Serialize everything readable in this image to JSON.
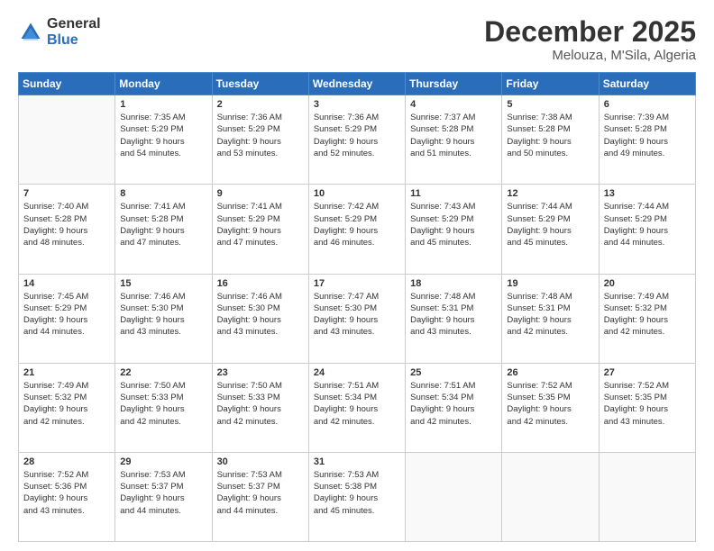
{
  "header": {
    "logo_general": "General",
    "logo_blue": "Blue",
    "month": "December 2025",
    "location": "Melouza, M'Sila, Algeria"
  },
  "weekdays": [
    "Sunday",
    "Monday",
    "Tuesday",
    "Wednesday",
    "Thursday",
    "Friday",
    "Saturday"
  ],
  "weeks": [
    [
      {
        "day": "",
        "info": ""
      },
      {
        "day": "1",
        "info": "Sunrise: 7:35 AM\nSunset: 5:29 PM\nDaylight: 9 hours\nand 54 minutes."
      },
      {
        "day": "2",
        "info": "Sunrise: 7:36 AM\nSunset: 5:29 PM\nDaylight: 9 hours\nand 53 minutes."
      },
      {
        "day": "3",
        "info": "Sunrise: 7:36 AM\nSunset: 5:29 PM\nDaylight: 9 hours\nand 52 minutes."
      },
      {
        "day": "4",
        "info": "Sunrise: 7:37 AM\nSunset: 5:28 PM\nDaylight: 9 hours\nand 51 minutes."
      },
      {
        "day": "5",
        "info": "Sunrise: 7:38 AM\nSunset: 5:28 PM\nDaylight: 9 hours\nand 50 minutes."
      },
      {
        "day": "6",
        "info": "Sunrise: 7:39 AM\nSunset: 5:28 PM\nDaylight: 9 hours\nand 49 minutes."
      }
    ],
    [
      {
        "day": "7",
        "info": "Sunrise: 7:40 AM\nSunset: 5:28 PM\nDaylight: 9 hours\nand 48 minutes."
      },
      {
        "day": "8",
        "info": "Sunrise: 7:41 AM\nSunset: 5:28 PM\nDaylight: 9 hours\nand 47 minutes."
      },
      {
        "day": "9",
        "info": "Sunrise: 7:41 AM\nSunset: 5:29 PM\nDaylight: 9 hours\nand 47 minutes."
      },
      {
        "day": "10",
        "info": "Sunrise: 7:42 AM\nSunset: 5:29 PM\nDaylight: 9 hours\nand 46 minutes."
      },
      {
        "day": "11",
        "info": "Sunrise: 7:43 AM\nSunset: 5:29 PM\nDaylight: 9 hours\nand 45 minutes."
      },
      {
        "day": "12",
        "info": "Sunrise: 7:44 AM\nSunset: 5:29 PM\nDaylight: 9 hours\nand 45 minutes."
      },
      {
        "day": "13",
        "info": "Sunrise: 7:44 AM\nSunset: 5:29 PM\nDaylight: 9 hours\nand 44 minutes."
      }
    ],
    [
      {
        "day": "14",
        "info": "Sunrise: 7:45 AM\nSunset: 5:29 PM\nDaylight: 9 hours\nand 44 minutes."
      },
      {
        "day": "15",
        "info": "Sunrise: 7:46 AM\nSunset: 5:30 PM\nDaylight: 9 hours\nand 43 minutes."
      },
      {
        "day": "16",
        "info": "Sunrise: 7:46 AM\nSunset: 5:30 PM\nDaylight: 9 hours\nand 43 minutes."
      },
      {
        "day": "17",
        "info": "Sunrise: 7:47 AM\nSunset: 5:30 PM\nDaylight: 9 hours\nand 43 minutes."
      },
      {
        "day": "18",
        "info": "Sunrise: 7:48 AM\nSunset: 5:31 PM\nDaylight: 9 hours\nand 43 minutes."
      },
      {
        "day": "19",
        "info": "Sunrise: 7:48 AM\nSunset: 5:31 PM\nDaylight: 9 hours\nand 42 minutes."
      },
      {
        "day": "20",
        "info": "Sunrise: 7:49 AM\nSunset: 5:32 PM\nDaylight: 9 hours\nand 42 minutes."
      }
    ],
    [
      {
        "day": "21",
        "info": "Sunrise: 7:49 AM\nSunset: 5:32 PM\nDaylight: 9 hours\nand 42 minutes."
      },
      {
        "day": "22",
        "info": "Sunrise: 7:50 AM\nSunset: 5:33 PM\nDaylight: 9 hours\nand 42 minutes."
      },
      {
        "day": "23",
        "info": "Sunrise: 7:50 AM\nSunset: 5:33 PM\nDaylight: 9 hours\nand 42 minutes."
      },
      {
        "day": "24",
        "info": "Sunrise: 7:51 AM\nSunset: 5:34 PM\nDaylight: 9 hours\nand 42 minutes."
      },
      {
        "day": "25",
        "info": "Sunrise: 7:51 AM\nSunset: 5:34 PM\nDaylight: 9 hours\nand 42 minutes."
      },
      {
        "day": "26",
        "info": "Sunrise: 7:52 AM\nSunset: 5:35 PM\nDaylight: 9 hours\nand 42 minutes."
      },
      {
        "day": "27",
        "info": "Sunrise: 7:52 AM\nSunset: 5:35 PM\nDaylight: 9 hours\nand 43 minutes."
      }
    ],
    [
      {
        "day": "28",
        "info": "Sunrise: 7:52 AM\nSunset: 5:36 PM\nDaylight: 9 hours\nand 43 minutes."
      },
      {
        "day": "29",
        "info": "Sunrise: 7:53 AM\nSunset: 5:37 PM\nDaylight: 9 hours\nand 44 minutes."
      },
      {
        "day": "30",
        "info": "Sunrise: 7:53 AM\nSunset: 5:37 PM\nDaylight: 9 hours\nand 44 minutes."
      },
      {
        "day": "31",
        "info": "Sunrise: 7:53 AM\nSunset: 5:38 PM\nDaylight: 9 hours\nand 45 minutes."
      },
      {
        "day": "",
        "info": ""
      },
      {
        "day": "",
        "info": ""
      },
      {
        "day": "",
        "info": ""
      }
    ]
  ]
}
